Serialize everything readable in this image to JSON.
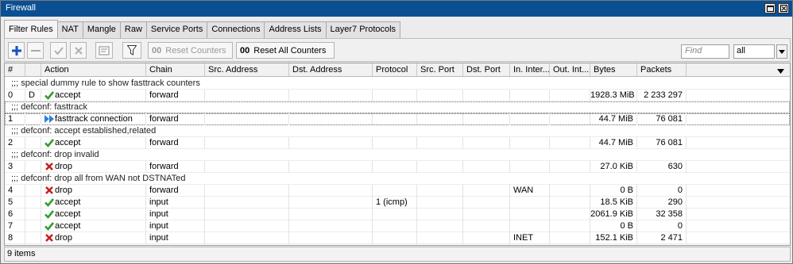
{
  "window": {
    "title": "Firewall"
  },
  "tabs": [
    "Filter Rules",
    "NAT",
    "Mangle",
    "Raw",
    "Service Ports",
    "Connections",
    "Address Lists",
    "Layer7 Protocols"
  ],
  "toolbar": {
    "reset_counters_oo": "00",
    "reset_counters_label": "Reset Counters",
    "reset_all_oo": "00",
    "reset_all_label": "Reset All Counters",
    "find_placeholder": "Find",
    "filter_value": "all"
  },
  "columns": [
    "#",
    "",
    "Action",
    "Chain",
    "Src. Address",
    "Dst. Address",
    "Protocol",
    "Src. Port",
    "Dst. Port",
    "In. Inter...",
    "Out. Int...",
    "Bytes",
    "Packets"
  ],
  "rows": [
    {
      "type": "comment",
      "text": ";;; special dummy rule to show fasttrack counters"
    },
    {
      "type": "rule",
      "num": "0",
      "flag": "D",
      "icon": "check-icon",
      "action": "accept",
      "chain": "forward",
      "src": "",
      "dst": "",
      "protocol": "",
      "sport": "",
      "dport": "",
      "in_if": "",
      "out_if": "",
      "bytes": "1928.3 MiB",
      "packets": "2 233 297"
    },
    {
      "type": "comment",
      "text": ";;; defconf: fasttrack",
      "boxed": true
    },
    {
      "type": "rule",
      "num": "1",
      "flag": "",
      "icon": "fasttrack-icon",
      "action": "fasttrack connection",
      "chain": "forward",
      "src": "",
      "dst": "",
      "protocol": "",
      "sport": "",
      "dport": "",
      "in_if": "",
      "out_if": "",
      "bytes": "44.7 MiB",
      "packets": "76 081",
      "boxed": true
    },
    {
      "type": "comment",
      "text": ";;; defconf: accept established,related"
    },
    {
      "type": "rule",
      "num": "2",
      "flag": "",
      "icon": "check-icon",
      "action": "accept",
      "chain": "forward",
      "src": "",
      "dst": "",
      "protocol": "",
      "sport": "",
      "dport": "",
      "in_if": "",
      "out_if": "",
      "bytes": "44.7 MiB",
      "packets": "76 081"
    },
    {
      "type": "comment",
      "text": ";;; defconf: drop invalid"
    },
    {
      "type": "rule",
      "num": "3",
      "flag": "",
      "icon": "cross-icon",
      "action": "drop",
      "chain": "forward",
      "src": "",
      "dst": "",
      "protocol": "",
      "sport": "",
      "dport": "",
      "in_if": "",
      "out_if": "",
      "bytes": "27.0 KiB",
      "packets": "630"
    },
    {
      "type": "comment",
      "text": ";;; defconf:  drop all from WAN not  DSTNATed"
    },
    {
      "type": "rule",
      "num": "4",
      "flag": "",
      "icon": "cross-icon",
      "action": "drop",
      "chain": "forward",
      "src": "",
      "dst": "",
      "protocol": "",
      "sport": "",
      "dport": "",
      "in_if": "WAN",
      "out_if": "",
      "bytes": "0 B",
      "packets": "0"
    },
    {
      "type": "rule",
      "num": "5",
      "flag": "",
      "icon": "check-icon",
      "action": "accept",
      "chain": "input",
      "src": "",
      "dst": "",
      "protocol": "1 (icmp)",
      "sport": "",
      "dport": "",
      "in_if": "",
      "out_if": "",
      "bytes": "18.5 KiB",
      "packets": "290"
    },
    {
      "type": "rule",
      "num": "6",
      "flag": "",
      "icon": "check-icon",
      "action": "accept",
      "chain": "input",
      "src": "",
      "dst": "",
      "protocol": "",
      "sport": "",
      "dport": "",
      "in_if": "",
      "out_if": "",
      "bytes": "2061.9 KiB",
      "packets": "32 358"
    },
    {
      "type": "rule",
      "num": "7",
      "flag": "",
      "icon": "check-icon",
      "action": "accept",
      "chain": "input",
      "src": "",
      "dst": "",
      "protocol": "",
      "sport": "",
      "dport": "",
      "in_if": "",
      "out_if": "",
      "bytes": "0 B",
      "packets": "0"
    },
    {
      "type": "rule",
      "num": "8",
      "flag": "",
      "icon": "cross-icon",
      "action": "drop",
      "chain": "input",
      "src": "",
      "dst": "",
      "protocol": "",
      "sport": "",
      "dport": "",
      "in_if": "INET",
      "out_if": "",
      "bytes": "152.1 KiB",
      "packets": "2 471"
    }
  ],
  "status": {
    "items_text": "9 items"
  },
  "colors": {
    "titlebar": "#0b4f93",
    "accept": "#2f9e2f",
    "drop": "#c62020",
    "fasttrack": "#2f7fd6",
    "add": "#1a4fc4"
  }
}
